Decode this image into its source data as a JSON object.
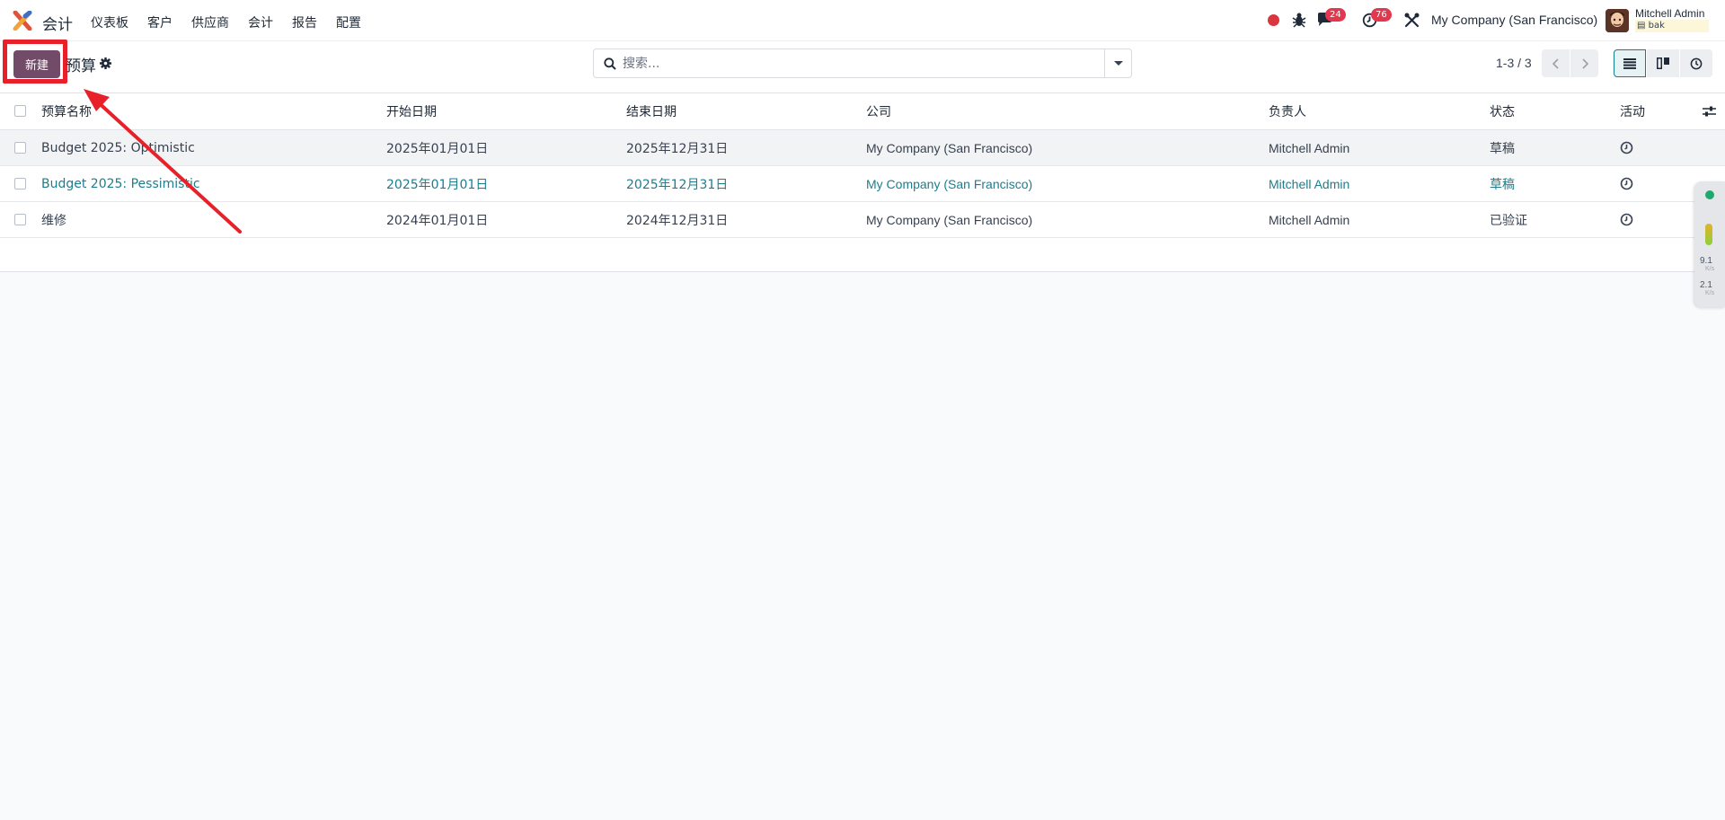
{
  "app": {
    "name": "会计",
    "menu": [
      "仪表板",
      "客户",
      "供应商",
      "会计",
      "报告",
      "配置"
    ]
  },
  "systray": {
    "messages_count": "24",
    "activities_count": "76",
    "company": "My Company (San Francisco)",
    "user_name": "Mitchell Admin",
    "database": "bak"
  },
  "control_panel": {
    "new_label": "新建",
    "title": "预算",
    "search_placeholder": "搜索...",
    "pager": "1-3 / 3"
  },
  "table": {
    "columns": [
      "预算名称",
      "开始日期",
      "结束日期",
      "公司",
      "负责人",
      "状态",
      "活动"
    ],
    "rows": [
      {
        "name": "Budget 2025: Optimistic",
        "start": "2025年01月01日",
        "end": "2025年12月31日",
        "company": "My Company (San Francisco)",
        "owner": "Mitchell Admin",
        "state": "草稿"
      },
      {
        "name": "Budget 2025: Pessimistic",
        "start": "2025年01月01日",
        "end": "2025年12月31日",
        "company": "My Company (San Francisco)",
        "owner": "Mitchell Admin",
        "state": "草稿"
      },
      {
        "name": "维修",
        "start": "2024年01月01日",
        "end": "2024年12月31日",
        "company": "My Company (San Francisco)",
        "owner": "Mitchell Admin",
        "state": "已验证"
      }
    ]
  },
  "side_widget": {
    "upload": "9.1",
    "download": "2.1",
    "unit": "K/s"
  },
  "colors": {
    "brand": "#714b67",
    "link": "#1d7d8c",
    "highlight": "#e8202a"
  }
}
